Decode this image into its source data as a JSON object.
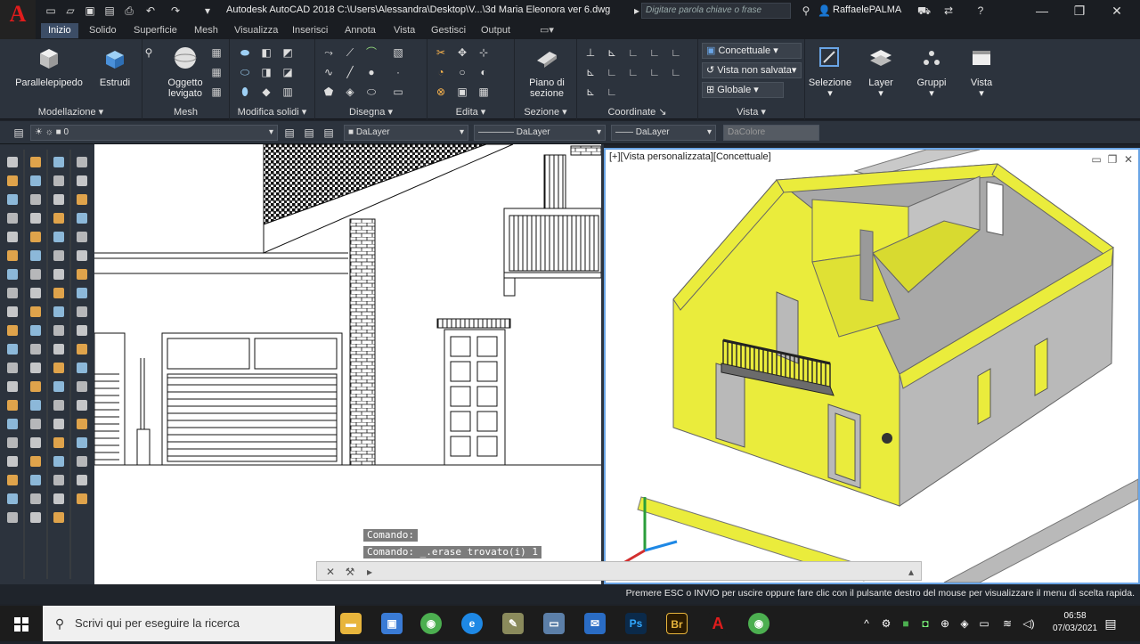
{
  "window": {
    "title": "Autodesk AutoCAD 2018    C:\\Users\\Alessandra\\Desktop\\V...\\3d Maria Eleonora ver 6.dwg",
    "search_placeholder": "Digitare parola chiave o frase",
    "user": "RaffaelePALMA"
  },
  "tabs": [
    "Inizio",
    "Solido",
    "Superficie",
    "Mesh",
    "Visualizza",
    "Inserisci",
    "Annota",
    "Vista",
    "Gestisci",
    "Output"
  ],
  "ribbon": {
    "modellazione": {
      "title": "Modellazione",
      "btn1": "Parallelepipedo",
      "btn2": "Estrudi"
    },
    "mesh": {
      "title": "Mesh",
      "btn1": "Oggetto",
      "btn1b": "levigato"
    },
    "modifica": {
      "title": "Modifica solidi"
    },
    "disegna": {
      "title": "Disegna"
    },
    "edita": {
      "title": "Edita"
    },
    "sezione": {
      "title": "Sezione",
      "btn1": "Piano di",
      "btn1b": "sezione"
    },
    "coordinate": {
      "title": "Coordinate"
    },
    "vista": {
      "title": "Vista",
      "style": "Concettuale",
      "saved_view": "Vista non salvata",
      "ucs": "Globale"
    },
    "selezione": "Selezione",
    "layer": "Layer",
    "gruppi": "Gruppi",
    "vista_btn": "Vista"
  },
  "propbar": {
    "layer": "0",
    "color": "DaLayer",
    "linetype": "DaLayer",
    "lineweight": "DaLayer",
    "plotstyle": "DaColore"
  },
  "viewport_right_label": "[+][Vista personalizzata][Concettuale]",
  "command": {
    "line1": "Comando:",
    "line2": "Comando:  _.erase trovato(i) 1"
  },
  "status_text": "Premere ESC o INVIO per uscire oppure fare clic con il pulsante destro del mouse per visualizzare il menu di scelta rapida.",
  "taskbar": {
    "search_placeholder": "Scrivi qui per eseguire la ricerca",
    "time": "06:58",
    "date": "07/03/2021"
  },
  "colors": {
    "accent": "#3c4d66",
    "wall_yellow": "#eaec3c",
    "wall_gray": "#b9b9b9",
    "autocad_red": "#e01c1c"
  }
}
